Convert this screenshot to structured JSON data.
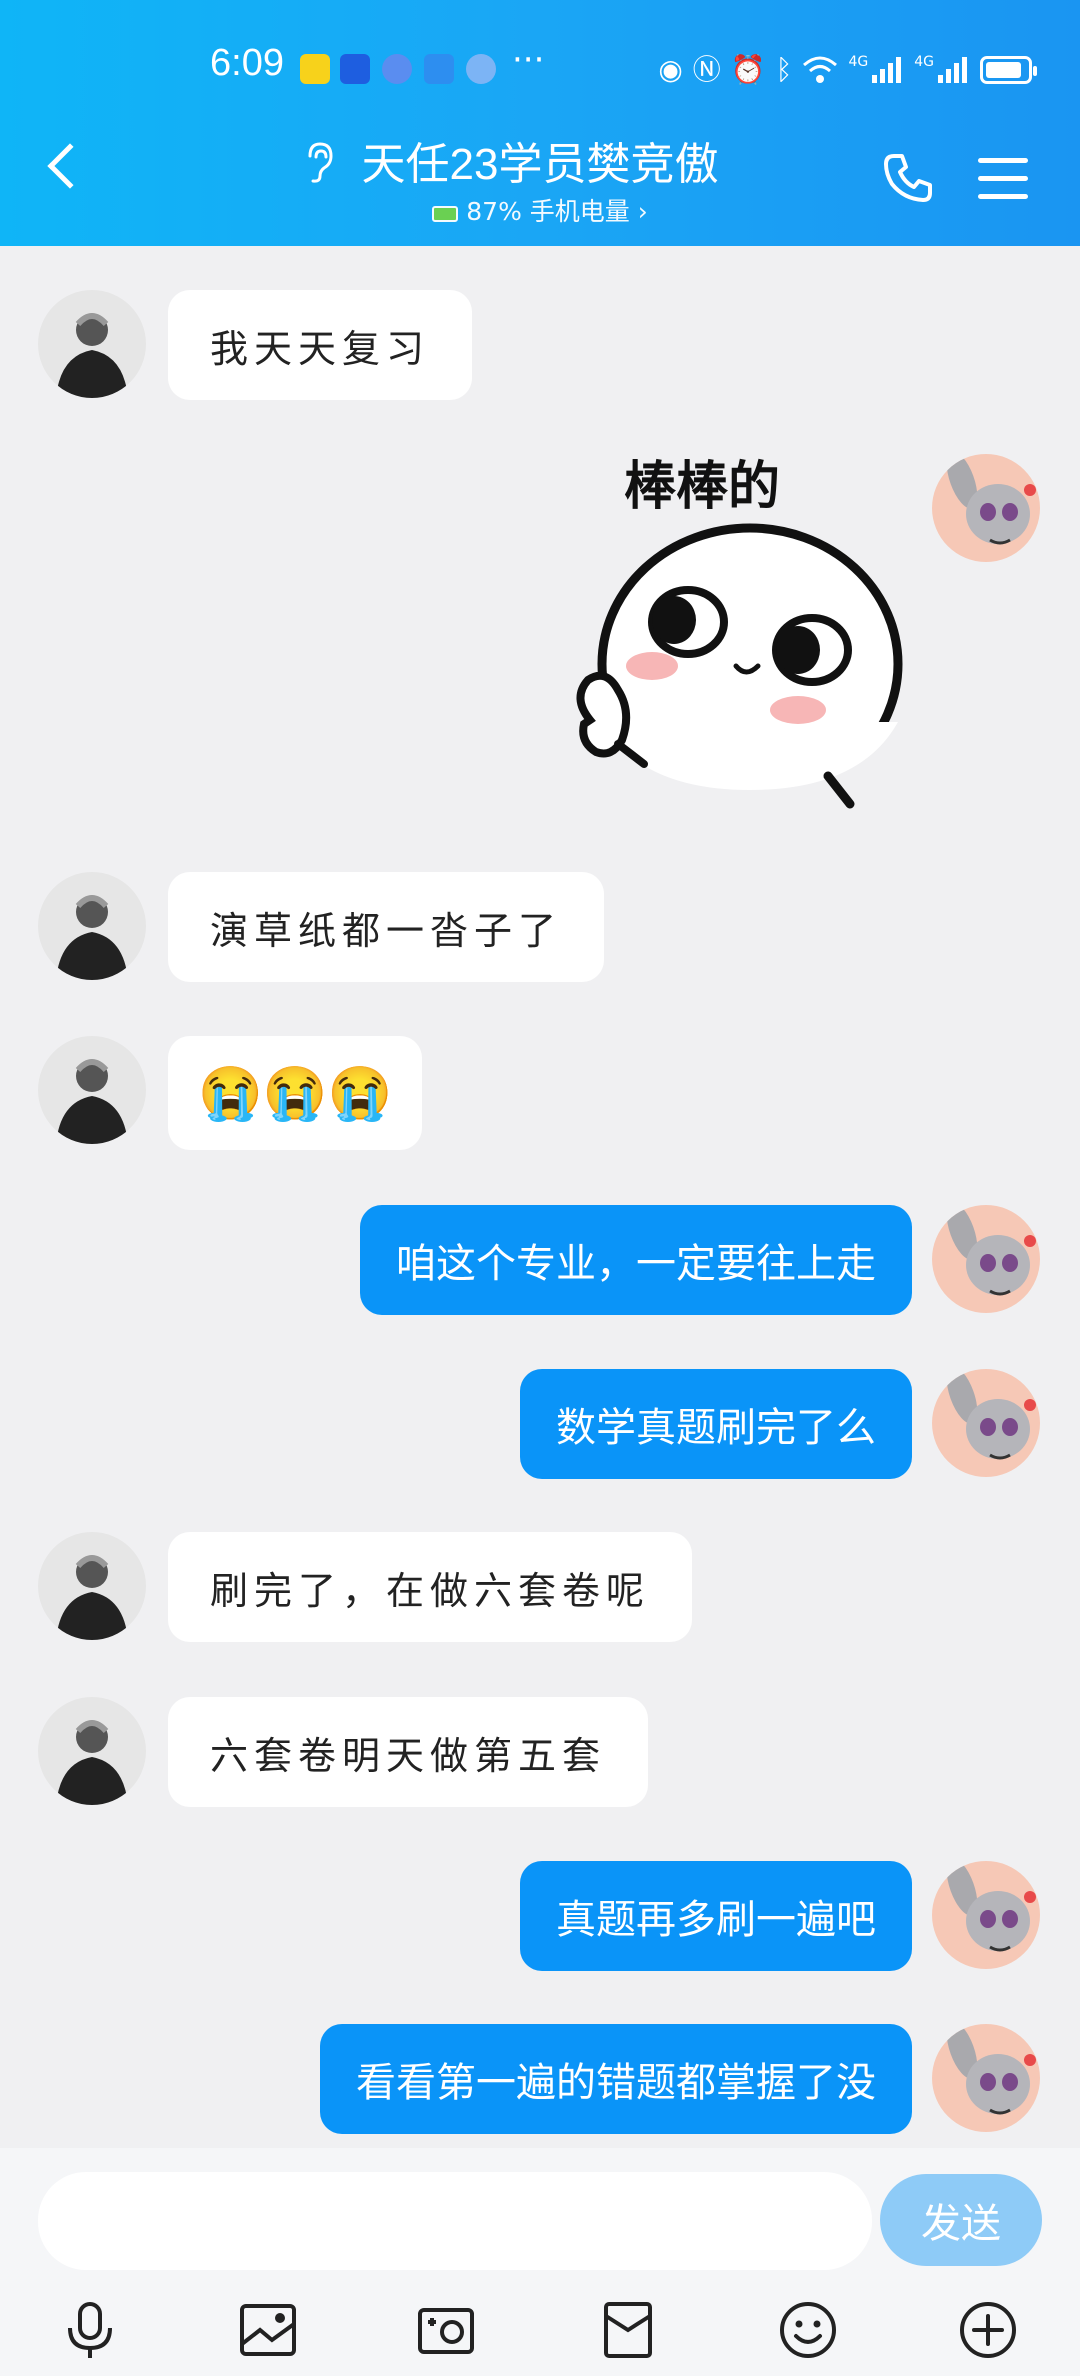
{
  "status_bar": {
    "time": "6:09",
    "more": "···",
    "network_1": "4G",
    "network_2": "4G"
  },
  "header": {
    "title": "天任23学员樊竞傲",
    "subtitle": "87% 手机电量 ›",
    "battery_level": 0.87
  },
  "messages": [
    {
      "side": "left",
      "text": "我天天复习"
    },
    {
      "side": "right",
      "sticker": true,
      "text": "棒棒的"
    },
    {
      "side": "left",
      "text": "演草纸都一沓子了"
    },
    {
      "side": "left",
      "emoji": "😭😭😭"
    },
    {
      "side": "right",
      "text": "咱这个专业，一定要往上走"
    },
    {
      "side": "right",
      "text": "数学真题刷完了么"
    },
    {
      "side": "left",
      "text": "刷完了，在做六套卷呢"
    },
    {
      "side": "left",
      "text": "六套卷明天做第五套"
    },
    {
      "side": "right",
      "text": "真题再多刷一遍吧"
    },
    {
      "side": "right",
      "text": "看看第一遍的错题都掌握了没"
    }
  ],
  "input": {
    "placeholder": "",
    "send_label": "发送"
  },
  "toolbar_icons": [
    "microphone-icon",
    "image-icon",
    "camera-icon",
    "red-packet-icon",
    "emoji-icon",
    "plus-icon"
  ],
  "colors": {
    "header": "#1aa6f5",
    "my_bubble": "#0a94f8",
    "send_disabled": "#8ecbf7"
  }
}
